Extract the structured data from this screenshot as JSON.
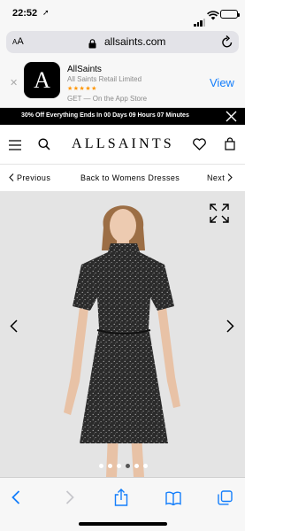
{
  "status": {
    "time": "22:52",
    "location_glyph": "➚"
  },
  "browser": {
    "aa_small": "A",
    "aa_large": "A",
    "url": "allsaints.com"
  },
  "app_banner": {
    "close": "✕",
    "icon_letter": "A",
    "name": "AllSaints",
    "company": "All Saints Retail Limited",
    "stars": "★★★★★",
    "get": "GET — On the App Store",
    "view": "View"
  },
  "promo": {
    "text": "30% Off Everything Ends In 00 Days 09 Hours 07 Minutes"
  },
  "header": {
    "logo": "ALLSAINTS"
  },
  "pager": {
    "previous": "Previous",
    "back": "Back to Womens Dresses",
    "next": "Next"
  },
  "carousel": {
    "total": 6,
    "active_index": 3
  },
  "colors": {
    "accent": "#147efb",
    "stars": "#ff9500",
    "promo_bg": "#000000",
    "product_bg": "#e4e4e4"
  },
  "icons": {
    "status": [
      "location-arrow-icon",
      "signal-icon",
      "wifi-icon",
      "battery-icon"
    ],
    "browser": [
      "lock-icon",
      "reload-icon"
    ],
    "nav": [
      "menu-icon",
      "search-icon",
      "heart-icon",
      "bag-icon"
    ],
    "product": [
      "expand-icon",
      "chevron-left-icon",
      "chevron-right-icon"
    ],
    "toolbar": [
      "back-icon",
      "forward-icon",
      "share-icon",
      "bookmarks-icon",
      "tabs-icon"
    ]
  }
}
